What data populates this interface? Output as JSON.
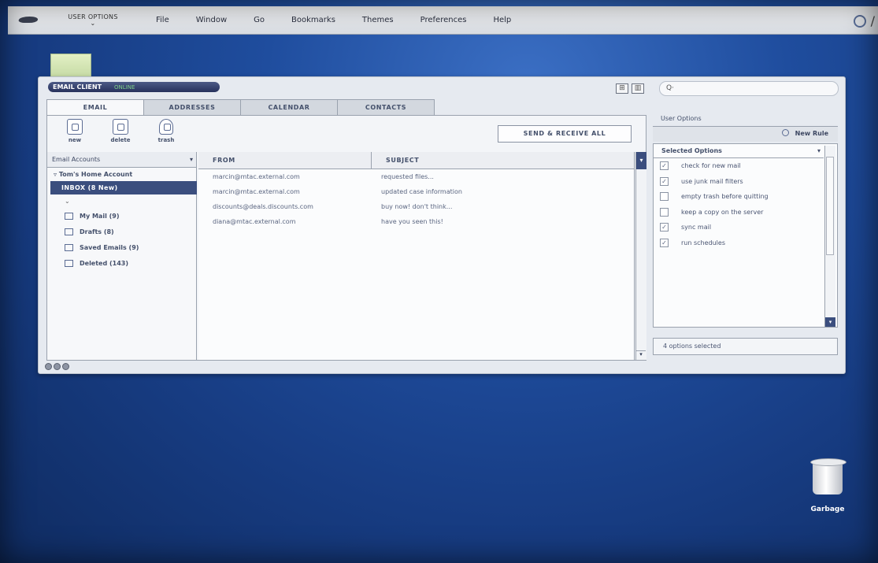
{
  "menubar": {
    "user_options": "USER OPTIONS",
    "items": [
      "File",
      "Window",
      "Go",
      "Bookmarks",
      "Themes",
      "Preferences",
      "Help"
    ]
  },
  "window": {
    "title": "EMAIL CLIENT",
    "status": "ONLINE",
    "search_placeholder": "Q·",
    "tabs": [
      "EMAIL",
      "ADDRESSES",
      "CALENDAR",
      "CONTACTS"
    ],
    "active_tab": "EMAIL",
    "toolbar": {
      "new": "new",
      "delete": "delete",
      "trash": "trash",
      "send_receive_all": "SEND & RECEIVE ALL"
    },
    "accounts": {
      "dropdown": "Email Accounts",
      "account_name": "Tom's Home Account",
      "inbox": "INBOX   (8 New)",
      "folders": [
        {
          "label": "My Mail   (9)"
        },
        {
          "label": "Drafts   (8)"
        },
        {
          "label": "Saved Emails   (9)"
        },
        {
          "label": "Deleted   (143)"
        }
      ]
    },
    "messages": {
      "headers": {
        "from": "FROM",
        "subject": "SUBJECT"
      },
      "rows": [
        {
          "from": "marcin@mtac.external.com",
          "subject": "requested files..."
        },
        {
          "from": "marcin@mtac.external.com",
          "subject": "updated case information"
        },
        {
          "from": "discounts@deals.discounts.com",
          "subject": "buy now! don't think..."
        },
        {
          "from": "diana@mtac.external.com",
          "subject": "have you seen this!"
        }
      ]
    },
    "user_options": {
      "title": "User Options",
      "new_rule": "New Rule",
      "dropdown": "Selected Options",
      "options": [
        {
          "label": "check for new mail",
          "checked": true
        },
        {
          "label": "use junk mail filters",
          "checked": true
        },
        {
          "label": "empty trash before quitting",
          "checked": false
        },
        {
          "label": "keep a copy on the server",
          "checked": false
        },
        {
          "label": "sync mail",
          "checked": true
        },
        {
          "label": "run schedules",
          "checked": true
        }
      ],
      "footer": "4 options selected"
    }
  },
  "desktop": {
    "garbage_label": "Garbage"
  }
}
